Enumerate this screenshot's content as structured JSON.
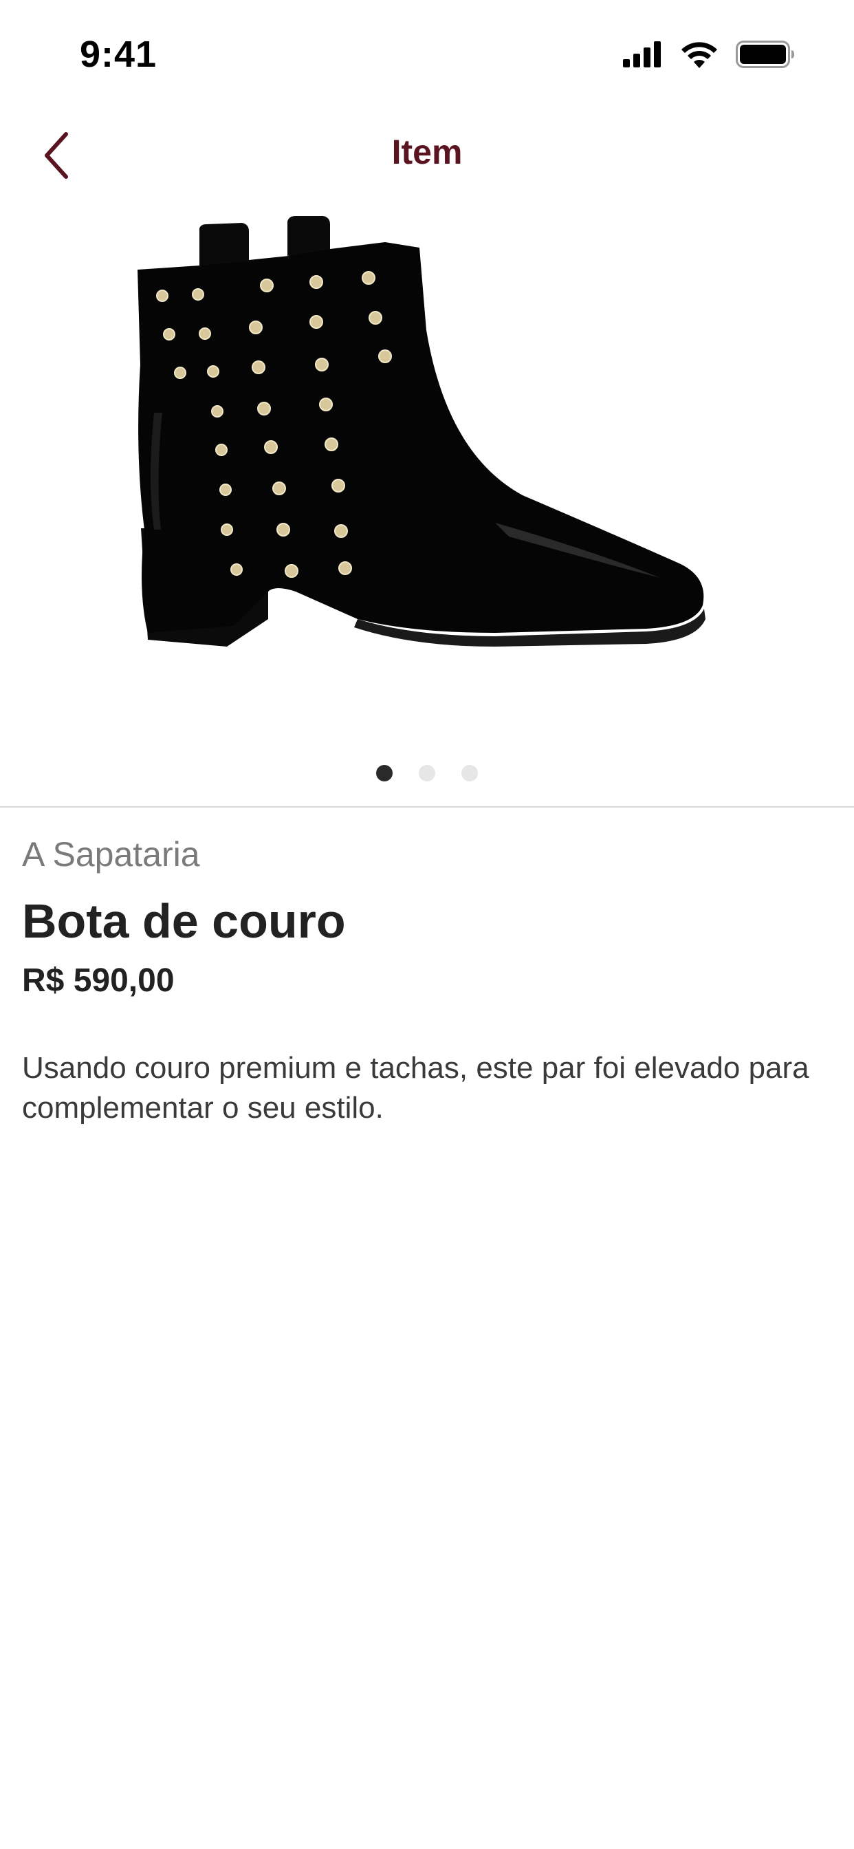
{
  "status_bar": {
    "time": "9:41",
    "icons": [
      "cellular-signal-icon",
      "wifi-icon",
      "battery-icon"
    ]
  },
  "nav": {
    "title": "Item",
    "back_icon": "chevron-left-icon"
  },
  "gallery": {
    "image": "black-studded-leather-boot",
    "page_count": 3,
    "current_page": 1
  },
  "product": {
    "store": "A Sapataria",
    "name": "Bota de couro",
    "price": "R$ 590,00",
    "description": "Usando couro premium e tachas, este par foi elevado para complementar o seu estilo."
  },
  "colors": {
    "accent": "#5a1420",
    "text": "#222222",
    "muted": "#7a7a7a",
    "dot_active": "#2a2a2a",
    "dot_inactive": "#e6e6e6"
  }
}
